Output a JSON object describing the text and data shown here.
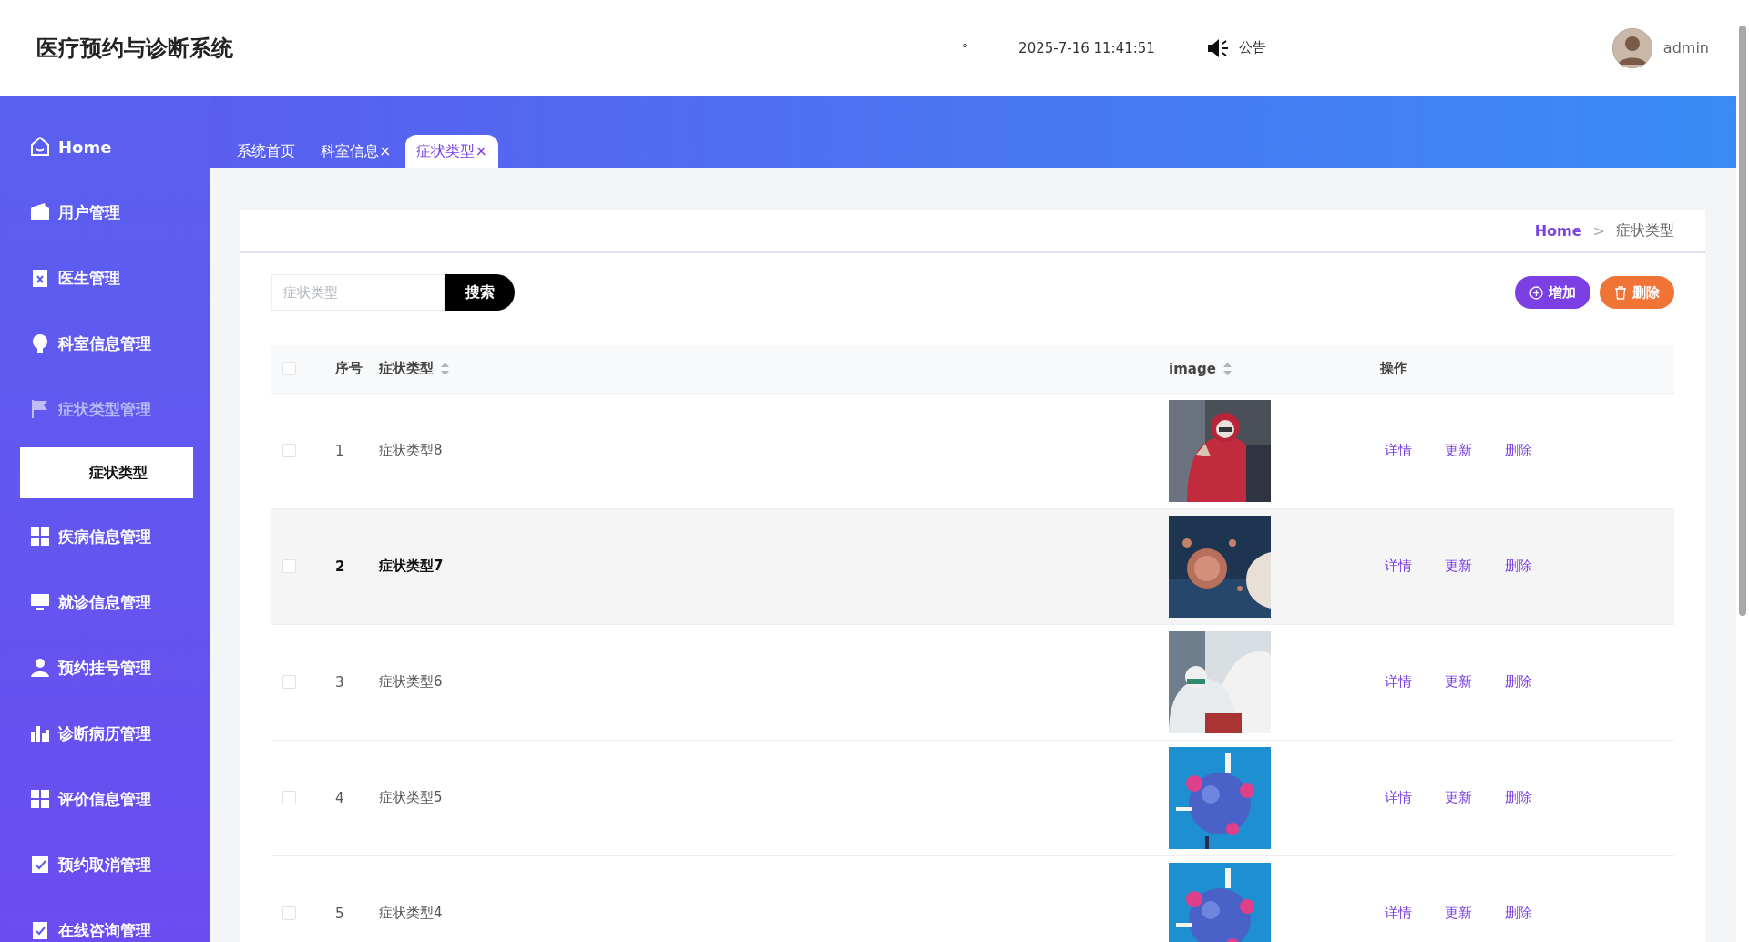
{
  "header": {
    "title": "医疗预约与诊断系统",
    "dot": "°",
    "datetime": "2025-7-16 11:41:51",
    "notice": "公告",
    "user": "admin"
  },
  "sidebar": {
    "items": [
      {
        "label": "Home",
        "expanded": false
      },
      {
        "label": "用户管理",
        "expanded": false
      },
      {
        "label": "医生管理",
        "expanded": false
      },
      {
        "label": "科室信息管理",
        "expanded": false
      },
      {
        "label": "症状类型管理",
        "expanded": true,
        "children": [
          {
            "label": "症状类型",
            "selected": true
          }
        ]
      },
      {
        "label": "疾病信息管理",
        "expanded": false
      },
      {
        "label": "就诊信息管理",
        "expanded": false
      },
      {
        "label": "预约挂号管理",
        "expanded": false
      },
      {
        "label": "诊断病历管理",
        "expanded": false
      },
      {
        "label": "评价信息管理",
        "expanded": false
      },
      {
        "label": "预约取消管理",
        "expanded": false
      },
      {
        "label": "在线咨询管理",
        "expanded": false
      }
    ]
  },
  "tabs": [
    {
      "label": "系统首页",
      "selected": false
    },
    {
      "label": "科室信息",
      "close": "×",
      "selected": false
    },
    {
      "label": "症状类型",
      "close": "×",
      "selected": true
    }
  ],
  "breadcrumb": [
    "Home",
    "症状类型"
  ],
  "breadcrumb_separator": ">",
  "search": {
    "placeholder": "症状类型",
    "button": "搜索"
  },
  "actions": {
    "add": "增加",
    "delete": "删除"
  },
  "table": {
    "header_checked": false,
    "columns": [
      {
        "label": "序号",
        "sortable": false
      },
      {
        "label": "症状类型",
        "sortable": true
      },
      {
        "label": "image",
        "sortable": true
      },
      {
        "label": "操作",
        "sortable": false
      }
    ],
    "rows": [
      {
        "checked": false,
        "hovered": false,
        "index": "1",
        "name": "症状类型8",
        "image": {
          "kind": "picture"
        },
        "ops": [
          "详情",
          "更新",
          "删除"
        ]
      },
      {
        "checked": false,
        "hovered": true,
        "index": "2",
        "name": "症状类型7",
        "image": {
          "kind": "picture"
        },
        "ops": [
          "详情",
          "更新",
          "删除"
        ]
      },
      {
        "checked": false,
        "hovered": false,
        "index": "3",
        "name": "症状类型6",
        "image": {
          "kind": "picture"
        },
        "ops": [
          "详情",
          "更新",
          "删除"
        ]
      },
      {
        "checked": false,
        "hovered": false,
        "index": "4",
        "name": "症状类型5",
        "image": {
          "kind": "picture"
        },
        "ops": [
          "详情",
          "更新",
          "删除"
        ]
      },
      {
        "checked": false,
        "hovered": false,
        "index": "5",
        "name": "症状类型4",
        "image": {
          "kind": "picture"
        },
        "ops": [
          "详情",
          "更新",
          "删除"
        ]
      }
    ]
  }
}
